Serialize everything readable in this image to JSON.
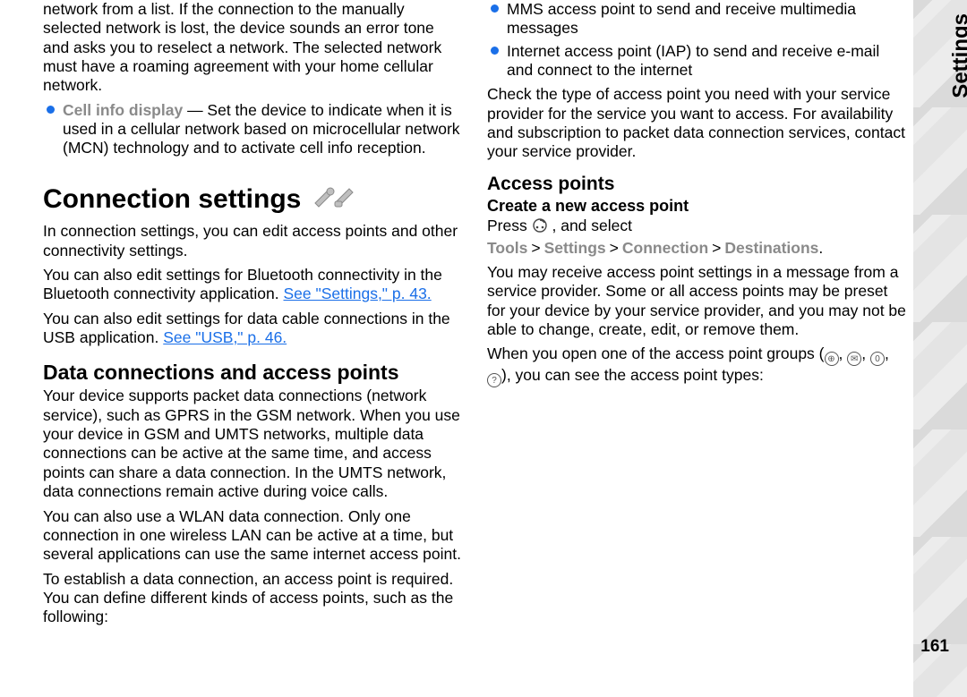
{
  "side_tab": "Settings",
  "page_number": "161",
  "col1": {
    "intro_cont": "network from a list. If the connection to the manually selected network is lost, the device sounds an error tone and asks you to reselect a network. The selected network must have a roaming agreement with your home cellular network.",
    "cell_info_label": "Cell info display",
    "cell_info_text": " — Set the device to indicate when it is used in a cellular network based on microcellular network (MCN) technology and to activate cell info reception.",
    "h1": "Connection settings",
    "p1": "In connection settings, you can edit access points and other connectivity settings.",
    "p2a": "You can also edit settings for Bluetooth connectivity in the Bluetooth connectivity application. ",
    "p2_link": "See \"Settings,\" p. 43.",
    "p3a": "You can also edit settings for data cable connections in the USB application. ",
    "p3_link": "See \"USB,\" p. 46.",
    "h2_data": "Data connections and access points",
    "p_data": "Your device supports packet data connections (network service), such as GPRS in the GSM network. When you use your device in GSM and UMTS networks, multiple data connections can be active at the same time, and access points can share a data connection. In the UMTS network, data connections remain active during voice calls."
  },
  "col2": {
    "p_wlan": "You can also use a WLAN data connection. Only one connection in one wireless LAN can be active at a time, but several applications can use the same internet access point.",
    "p_est": "To establish a data connection, an access point is required. You can define different kinds of access points, such as the following:",
    "ap_bullets": [
      "MMS access point to send and receive multimedia messages",
      "Internet access point (IAP) to send and receive e-mail and connect to the internet"
    ],
    "p_check": "Check the type of access point you need with your service provider for the service you want to access. For availability and subscription to packet data connection services, contact your service provider.",
    "h3_ap": "Access points",
    "h4_create": "Create a new access point",
    "press_label": "Press ",
    "press_tail": " , and select ",
    "menu": [
      "Tools",
      "Settings",
      "Connection",
      "Destinations"
    ],
    "p_msg": "You may receive access point settings in a message from a service provider. Some or all access points may be preset for your device by your service provider, and you may not be able to change, create, edit, or remove them.",
    "p_groups_a": "When you open one of the access point groups (",
    "p_groups_b": "), you can see the access point types:"
  }
}
